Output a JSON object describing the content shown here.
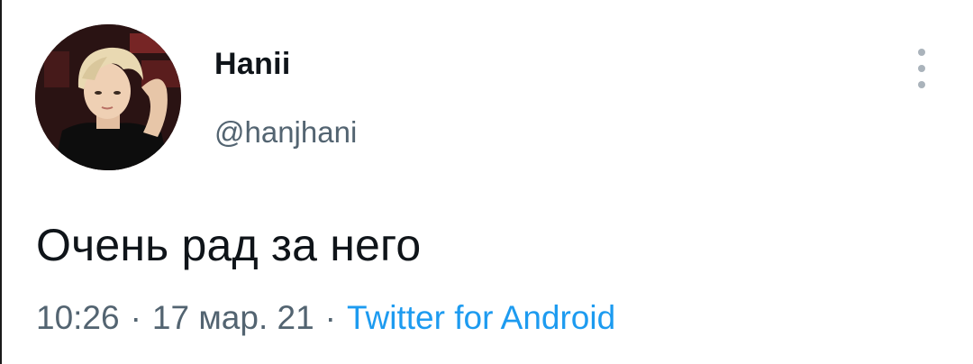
{
  "tweet": {
    "author": {
      "display_name": "Hanii",
      "handle": "@hanjhani",
      "avatar_icon": "user-avatar-photo"
    },
    "text": "Очень рад за него",
    "meta": {
      "time": "10:26",
      "date": "17 мар. 21",
      "separator": "·",
      "source": "Twitter for Android"
    },
    "more_icon": "more-vertical-icon"
  },
  "colors": {
    "text_primary": "#0f1419",
    "text_secondary": "#536471",
    "link": "#1d9bf0",
    "menu_dots": "#aab3bb"
  }
}
